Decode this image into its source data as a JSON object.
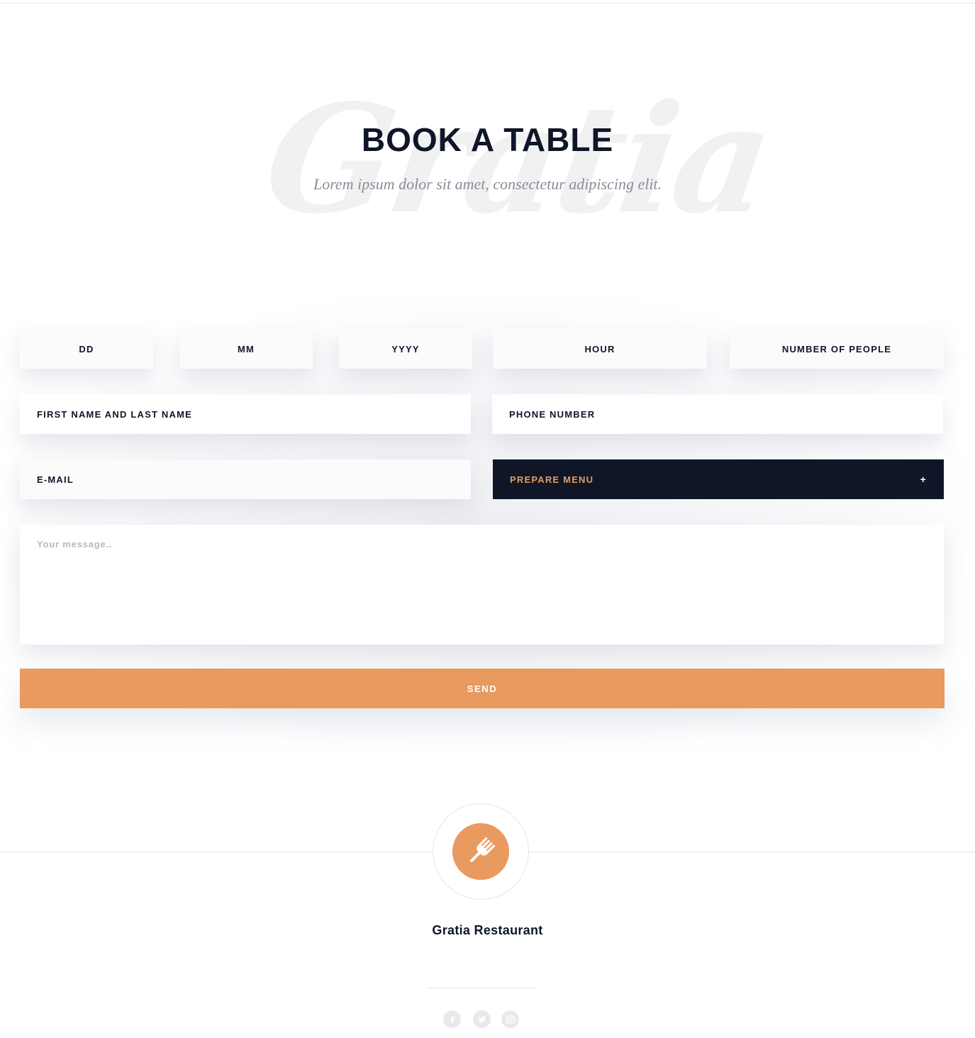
{
  "hero": {
    "watermark": "Gratia",
    "title": "BOOK A TABLE",
    "subtitle": "Lorem ipsum dolor sit amet, consectetur adipiscing elit."
  },
  "form": {
    "day": "DD",
    "month": "MM",
    "year": "YYYY",
    "hour": "HOUR",
    "people": "NUMBER OF PEOPLE",
    "name": "FIRST NAME AND LAST NAME",
    "phone": "PHONE NUMBER",
    "email": "E-MAIL",
    "menu_label": "PREPARE MENU",
    "menu_toggle": "+",
    "message_placeholder": "Your message..",
    "send_label": "SEND"
  },
  "footer": {
    "logo_icon": "fork-icon",
    "brand": "Gratia Restaurant",
    "social": [
      "facebook-icon",
      "twitter-icon",
      "instagram-icon"
    ]
  },
  "colors": {
    "accent": "#e99a5e",
    "navy": "#0e1628",
    "muted": "#8a8d99"
  }
}
